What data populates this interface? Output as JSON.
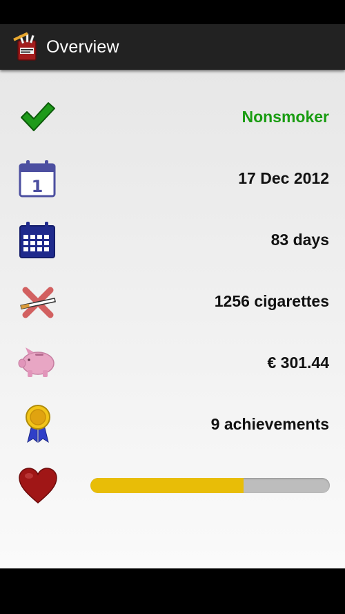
{
  "app": {
    "title": "Overview"
  },
  "rows": [
    {
      "icon": "check-icon",
      "value": "Nonsmoker"
    },
    {
      "icon": "calendar-day-icon",
      "value": "17 Dec 2012"
    },
    {
      "icon": "calendar-month-icon",
      "value": "83 days"
    },
    {
      "icon": "crossed-cigarette-icon",
      "value": "1256 cigarettes"
    },
    {
      "icon": "piggy-bank-icon",
      "value": "€ 301.44"
    },
    {
      "icon": "award-ribbon-icon",
      "value": "9 achievements"
    },
    {
      "icon": "heart-icon",
      "progress": 0.64
    }
  ],
  "colors": {
    "status_green": "#1a9c12",
    "progress_fill": "#e8bd07",
    "progress_track": "#bdbdbd"
  }
}
